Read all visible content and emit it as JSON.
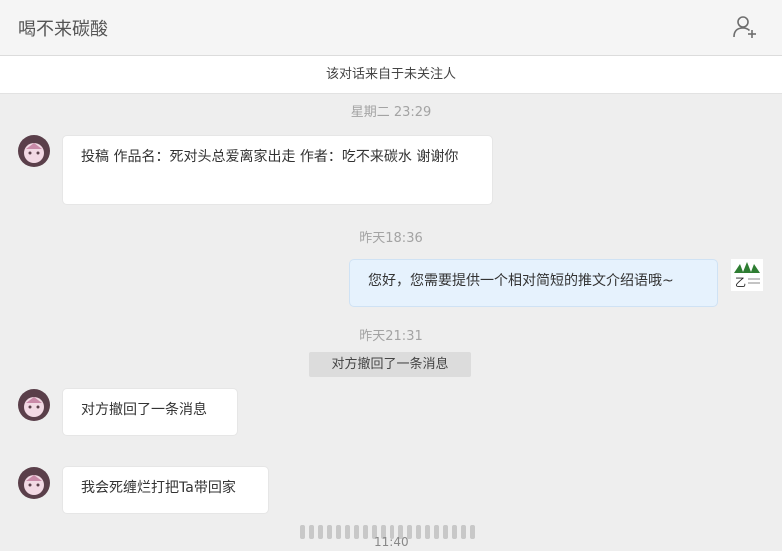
{
  "header": {
    "title": "喝不来碳酸",
    "add_icon": "add-contact-icon"
  },
  "notice": "该对话来自于未关注人",
  "messages": [
    {
      "timestamp": "星期二 23:29",
      "sender": "other",
      "text": "投稿 作品名：死对头总爱离家出走 作者：吃不来碳水 谢谢你"
    },
    {
      "timestamp": "昨天18:36",
      "sender": "self",
      "text": "您好，您需要提供一个相对简短的推文介绍语哦~"
    },
    {
      "timestamp": "昨天21:31",
      "system": "对方撤回了一条消息"
    },
    {
      "sender": "other",
      "text": "对方撤回了一条消息"
    },
    {
      "sender": "other",
      "text": "我会死缠烂打把Ta带回家"
    }
  ],
  "bottom_time": "11:40"
}
